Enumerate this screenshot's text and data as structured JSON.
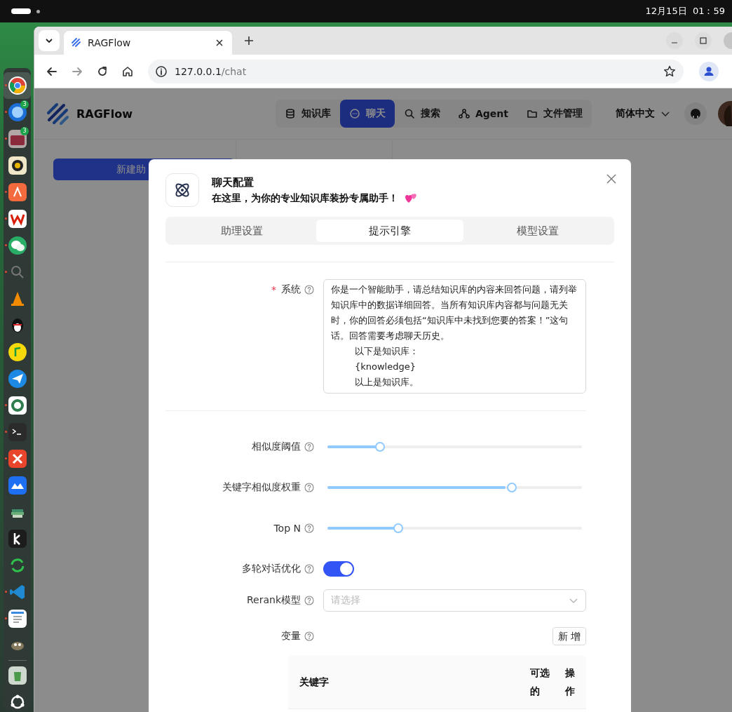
{
  "system_bar": {
    "clock": "12月15日  01：59"
  },
  "dock": {
    "items": [
      {
        "kind": "browser",
        "running": true
      },
      {
        "kind": "mail",
        "running": true,
        "badge": "3"
      },
      {
        "kind": "files",
        "running": true,
        "badge": "3"
      },
      {
        "kind": "speaker",
        "running": false
      },
      {
        "kind": "store",
        "running": true
      },
      {
        "kind": "office",
        "running": true
      },
      {
        "kind": "chat",
        "running": true
      },
      {
        "kind": "search",
        "running": true
      },
      {
        "kind": "cone",
        "running": false
      },
      {
        "kind": "penguin",
        "running": false
      },
      {
        "kind": "music",
        "running": false
      },
      {
        "kind": "plane",
        "running": false
      },
      {
        "kind": "globe",
        "running": true
      },
      {
        "kind": "terminal",
        "running": true
      },
      {
        "kind": "mindmap",
        "running": true
      },
      {
        "kind": "cloud",
        "running": false
      },
      {
        "kind": "books",
        "running": false
      },
      {
        "kind": "bookmark",
        "running": false
      },
      {
        "kind": "sync",
        "running": false
      },
      {
        "kind": "code",
        "running": true
      },
      {
        "kind": "notepad",
        "running": true
      },
      {
        "kind": "gimp",
        "running": false
      },
      {
        "kind": "trash",
        "running": false
      },
      {
        "kind": "launcher",
        "running": false
      }
    ]
  },
  "browser": {
    "tab": {
      "title": "RAGFlow"
    },
    "url": {
      "host": "127.0.0.1",
      "path": "/chat"
    }
  },
  "app": {
    "logo": "RAGFlow",
    "nav": [
      {
        "label": "知识库",
        "selected": false
      },
      {
        "label": "聊天",
        "selected": true
      },
      {
        "label": "搜索",
        "selected": false
      },
      {
        "label": "Agent",
        "selected": false
      },
      {
        "label": "文件管理",
        "selected": false
      }
    ],
    "language": "简体中文",
    "new_button": "新建助"
  },
  "dialog": {
    "title": "聊天配置",
    "subtitle": "在这里，为你的专业知识库装扮专属助手！",
    "tabs": [
      {
        "label": "助理设置",
        "selected": false
      },
      {
        "label": "提示引擎",
        "selected": true
      },
      {
        "label": "模型设置",
        "selected": false
      }
    ],
    "system": {
      "label": "系统",
      "required_mark": "*",
      "lines": [
        {
          "text": "你是一个智能助手，请总结知识库的内容来回答问题，请列举知识库中的数据详细回答。当所有知识库内容都与问题无关时，你的回答必须包括“知识库中未找到您要的答案！”这句话。回答需要考虑聊天历史。",
          "indent": false
        },
        {
          "text": "以下是知识库：",
          "indent": true
        },
        {
          "text": "{knowledge}",
          "indent": true
        },
        {
          "text": "以上是知识库。",
          "indent": true
        }
      ]
    },
    "fields": [
      {
        "kind": "slider",
        "label": "相似度阈值",
        "level": 0.2
      },
      {
        "kind": "slider",
        "label": "关键字相似度权重",
        "level": 0.7
      },
      {
        "kind": "slider",
        "label": "Top N",
        "level": 0.27
      },
      {
        "kind": "switch",
        "label": "多轮对话优化",
        "on": true
      },
      {
        "kind": "select",
        "label": "Rerank模型",
        "placeholder": "请选择"
      },
      {
        "kind": "add",
        "label": "变量",
        "button": "新 增"
      }
    ],
    "table": {
      "columns": [
        "关键字",
        "可选的",
        "操作"
      ]
    }
  }
}
